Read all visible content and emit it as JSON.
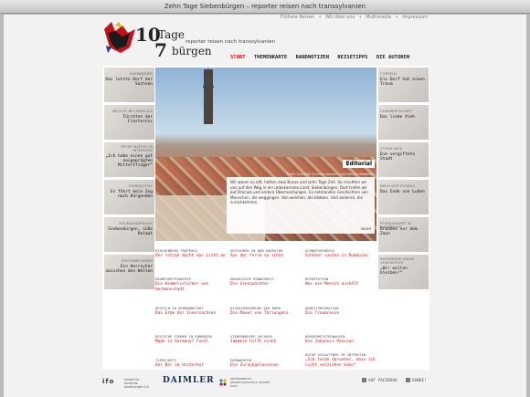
{
  "window": {
    "title": "Zehn Tage Siebenbürgen – reporter reisen nach transsylvanien"
  },
  "logo": {
    "ten": "10",
    "tage": "Tage",
    "seven": "7",
    "burgen": "bürgen",
    "subtitle": "reporter reisen nach transsylvanien"
  },
  "meta_nav": [
    "Frühere Reisen",
    "•",
    "Wir über uns",
    "•",
    "Multimedia",
    "•",
    "Impressum"
  ],
  "main_nav": [
    {
      "label": "START",
      "active": true
    },
    {
      "label": "THEMENKARTE",
      "active": false
    },
    {
      "label": "RANDNOTIZEN",
      "active": false
    },
    {
      "label": "REISETIPPS",
      "active": false
    },
    {
      "label": "DIE AUTOREN",
      "active": false
    }
  ],
  "left_items": [
    {
      "cat": "AUSWANDER",
      "title": "Das letzte Dorf der Sachsen"
    },
    {
      "cat": "BESUCH BEI DRACULA",
      "title": "Fürchten der Finsternis"
    },
    {
      "cat": "PETER MAFFAY IM INTERVIEW",
      "title": "„Ich habe einen gut ausgeprägten Mitteltfinger“"
    },
    {
      "cat": "HARBACHTAL",
      "title": "Es fährt kein Zug nach Hürgenden"
    },
    {
      "cat": "RÜCKWANDERUNG",
      "title": "Siebenbürgen, süße Heimat"
    },
    {
      "cat": "ZIEGENBRONNEN",
      "title": "Ein Herrscher zwischen den Welten"
    }
  ],
  "right_items": [
    {
      "cat": "CORTELN",
      "title": "Ein Dorf hat einen Traum"
    },
    {
      "cat": "LANDWIRTSCHAFT",
      "title": "Das liebe Vieh"
    },
    {
      "cat": "COPSA MICA",
      "title": "Die vergiftete Stadt"
    },
    {
      "cat": "NACH DER EXODUS",
      "title": "Das Ende von Luden"
    },
    {
      "cat": "PFERDEMARKT IN KARBESCHT",
      "title": "Draußen vor dem Zaun"
    },
    {
      "cat": "RUMÄNIENS JUNGE GENERATION",
      "title": "„Wir wollen bleiben!“"
    }
  ],
  "hero": {
    "photo_credit": "Foto: Dominik Eberlschweizer und Nenyo Möderler",
    "editorial_label": "Editorial",
    "editorial_text": "Wir waren zu elft, hatten zwei Busse und zehn Tage Zeit. So machten wir uns auf den Weg in ein unbekanntes Land: Siebenbürgen. Dort trafen wir auf Dracula und andere Überraschungen. Es entstanden Geschichten von Menschen, die weggingen. Von welchen, die blieben. Und anderen, die zurückkehrten.",
    "more": "MEHR"
  },
  "grid": [
    [
      {
        "cat": "KIRCHENBURG TRAPPOLD",
        "title": "Der letzte macht das Licht an"
      },
      {
        "cat": "SKIFAHREN IN DEN KARPATEN",
        "title": "Aus der Ferne so schön"
      },
      {
        "cat": "SCHNAPSGENÜSSE",
        "title": "Schöner saufen in Rumänien"
      }
    ],
    [
      {
        "cat": "RAUMFAHRTPIONIERE",
        "title": "Die Himmelsstürmer von Hermannstadt"
      },
      {
        "cat": "UNGARISCHE MINDERHEIT",
        "title": "Die Grenzwächter"
      },
      {
        "cat": "DEPORTATION",
        "title": "Was ein Mensch aushält"
      }
    ],
    [
      {
        "cat": "DEUTSCH IN HERMANNSTADT",
        "title": "Das Erbe der Innersachsen"
      },
      {
        "cat": "DISKRIMINIERUNG DER ROMA",
        "title": "Die Mauer von Tărlungeni"
      },
      {
        "cat": "ARBEITSMIGRATION",
        "title": "Die Traumreise"
      }
    ],
    [
      {
        "cat": "DEUTSCHE FIRMEN IN RUMÄNIEN",
        "title": "Made in Germany? Fast!"
      },
      {
        "cat": "SIEBENBÜRGER SACHSEN",
        "title": "Jammere hilft nicht"
      },
      {
        "cat": "BÜRGERMEISTERWAHLEN",
        "title": "Die Johannis-Passion"
      }
    ],
    [
      {
        "cat": "TIERSCHUTZ",
        "title": "Der Bär im Hinterhof"
      },
      {
        "cat": "EUROWAHLEN",
        "title": "Die Zurückgelassenen"
      },
      {
        "cat": "AUTOR SCHLATTNER IM INTERVIEW",
        "title": "„Ich leide darunter, dass ich nicht verziehen kann“"
      }
    ]
  ],
  "footer": {
    "ifo": "ifo",
    "institute": "Institut für Auslands­beziehungen e.V.",
    "daimler": "DAIMLER",
    "school": "ZEITENSPIEGEL - REPORTAGESCHULE GÜNTER DAHL",
    "facebook": "AUF FACEBOOK",
    "thanks": "DANKE!"
  },
  "colors": {
    "accent": "#c8141c",
    "nav_active": "#d01010"
  }
}
